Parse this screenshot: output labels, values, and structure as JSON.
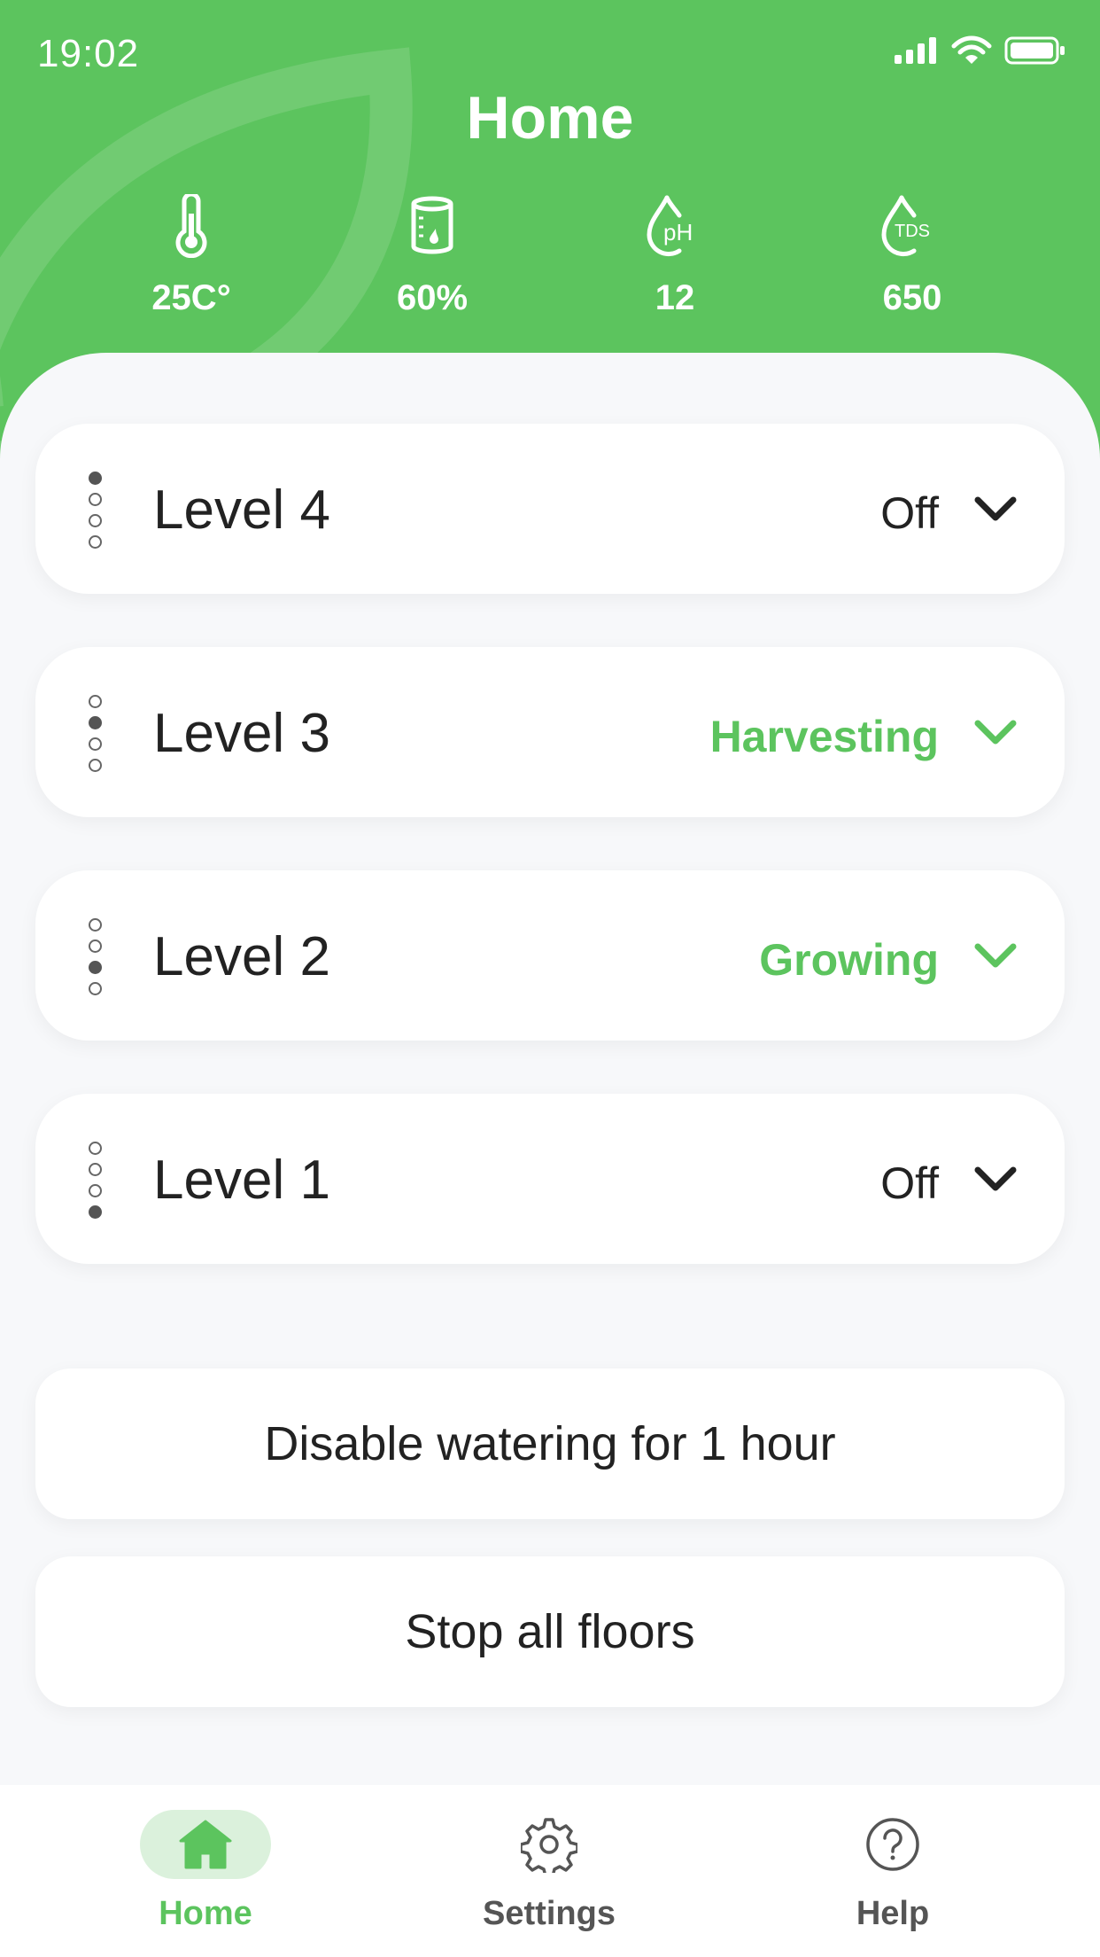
{
  "status_bar": {
    "time": "19:02"
  },
  "header": {
    "title": "Home"
  },
  "metrics": [
    {
      "icon": "thermometer-icon",
      "value": "25C°"
    },
    {
      "icon": "water-tank-icon",
      "value": "60%"
    },
    {
      "icon": "ph-drop-icon",
      "icon_text": "pH",
      "value": "12"
    },
    {
      "icon": "tds-drop-icon",
      "icon_text": "TDS",
      "value": "650"
    }
  ],
  "levels": [
    {
      "name": "Level 4",
      "status": "Off",
      "active_dot": 1
    },
    {
      "name": "Level 3",
      "status": "Harvesting",
      "active_dot": 2
    },
    {
      "name": "Level 2",
      "status": "Growing",
      "active_dot": 3
    },
    {
      "name": "Level 1",
      "status": "Off",
      "active_dot": 4
    }
  ],
  "actions": {
    "disable_watering": "Disable watering for 1 hour",
    "stop_all": "Stop all floors"
  },
  "tabs": [
    {
      "label": "Home",
      "icon": "home-icon",
      "active": true
    },
    {
      "label": "Settings",
      "icon": "gear-icon",
      "active": false
    },
    {
      "label": "Help",
      "icon": "help-icon",
      "active": false
    }
  ],
  "colors": {
    "brand_green": "#5cc45e",
    "background": "#f7f8fa",
    "tab_active_bg": "#dbf1dc"
  }
}
